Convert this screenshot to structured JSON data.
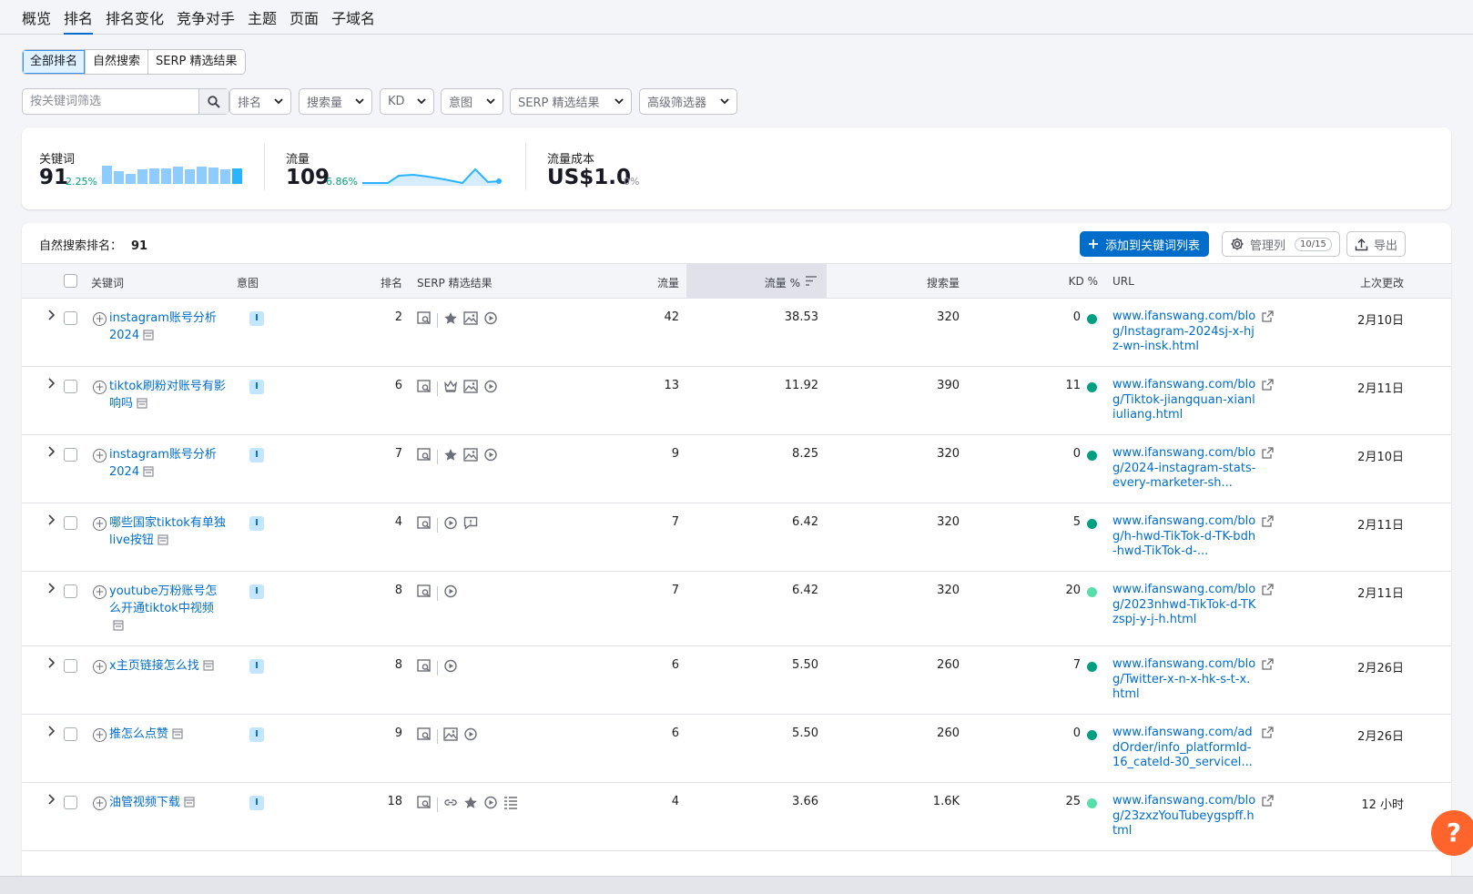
{
  "nav": {
    "tabs": [
      "概览",
      "排名",
      "排名变化",
      "竞争对手",
      "主题",
      "页面",
      "子域名"
    ],
    "active": 1
  },
  "segments": [
    "全部排名",
    "自然搜索",
    "SERP 精选结果"
  ],
  "filters": {
    "search_placeholder": "按关键词筛选",
    "dropdowns": [
      "排名",
      "搜索量",
      "KD",
      "意图",
      "SERP 精选结果",
      "高级筛选器"
    ]
  },
  "summary": {
    "keywords": {
      "label": "关键词",
      "value": "91",
      "change": "2.25%"
    },
    "traffic": {
      "label": "流量",
      "value": "109",
      "change": "6.86%"
    },
    "cost": {
      "label": "流量成本",
      "value": "US$1.0",
      "change": "0%"
    }
  },
  "table": {
    "title": "自然搜索排名：",
    "count": "91",
    "add_button": "添加到关键词列表",
    "manage_button": "管理列",
    "manage_badge": "10/15",
    "export_button": "导出",
    "headers": {
      "keyword": "关键词",
      "intent": "意图",
      "position": "排名",
      "serp": "SERP 精选结果",
      "traffic": "流量",
      "traffic_pct": "流量 %",
      "volume": "搜索量",
      "kd": "KD %",
      "url": "URL",
      "updated": "上次更改"
    },
    "rows": [
      {
        "keyword": "instagram账号分析 2024",
        "intent": "I",
        "position": "2",
        "traffic": "42",
        "traffic_pct": "38.53",
        "volume": "320",
        "kd": "0",
        "kd_color": "#009f81",
        "url": "www.ifanswang.com/blog/Instagram-2024sj-x-hjz-wn-insk.html",
        "updated": "2月10日"
      },
      {
        "keyword": "tiktok刷粉对账号有影响吗",
        "intent": "I",
        "position": "6",
        "traffic": "13",
        "traffic_pct": "11.92",
        "volume": "390",
        "kd": "11",
        "kd_color": "#009f81",
        "url": "www.ifanswang.com/blog/Tiktok-jiangquan-xianliuliang.html",
        "updated": "2月11日"
      },
      {
        "keyword": "instagram账号分析 2024",
        "intent": "I",
        "position": "7",
        "traffic": "9",
        "traffic_pct": "8.25",
        "volume": "320",
        "kd": "0",
        "kd_color": "#009f81",
        "url": "www.ifanswang.com/blog/2024-instagram-stats-every-marketer-sh...",
        "updated": "2月10日"
      },
      {
        "keyword": "哪些国家tiktok有单独live按钮",
        "intent": "I",
        "position": "4",
        "traffic": "7",
        "traffic_pct": "6.42",
        "volume": "320",
        "kd": "5",
        "kd_color": "#009f81",
        "url": "www.ifanswang.com/blog/h-hwd-TikTok-d-TK-bdh-hwd-TikTok-d-...",
        "updated": "2月11日"
      },
      {
        "keyword": "youtube万粉账号怎么开通tiktok中视频",
        "intent": "I",
        "position": "8",
        "traffic": "7",
        "traffic_pct": "6.42",
        "volume": "320",
        "kd": "20",
        "kd_color": "#59ddaa",
        "url": "www.ifanswang.com/blog/2023nhwd-TikTok-d-TKzspj-y-j-h.html",
        "updated": "2月11日"
      },
      {
        "keyword": "x主页链接怎么找",
        "intent": "I",
        "position": "8",
        "traffic": "6",
        "traffic_pct": "5.50",
        "volume": "260",
        "kd": "7",
        "kd_color": "#009f81",
        "url": "www.ifanswang.com/blog/Twitter-x-n-x-hk-s-t-x.html",
        "updated": "2月26日"
      },
      {
        "keyword": "推怎么点赞",
        "intent": "I",
        "position": "9",
        "traffic": "6",
        "traffic_pct": "5.50",
        "volume": "260",
        "kd": "0",
        "kd_color": "#009f81",
        "url": "www.ifanswang.com/addOrder/info_platformId-16_cateId-30_serviceI...",
        "updated": "2月26日"
      },
      {
        "keyword": "油管视频下载",
        "intent": "I",
        "position": "18",
        "traffic": "4",
        "traffic_pct": "3.66",
        "volume": "1.6K",
        "kd": "25",
        "kd_color": "#59ddaa",
        "url": "www.ifanswang.com/blog/23zxzYouTubeygspff.html",
        "updated": "12 小时"
      }
    ]
  },
  "help": "?"
}
